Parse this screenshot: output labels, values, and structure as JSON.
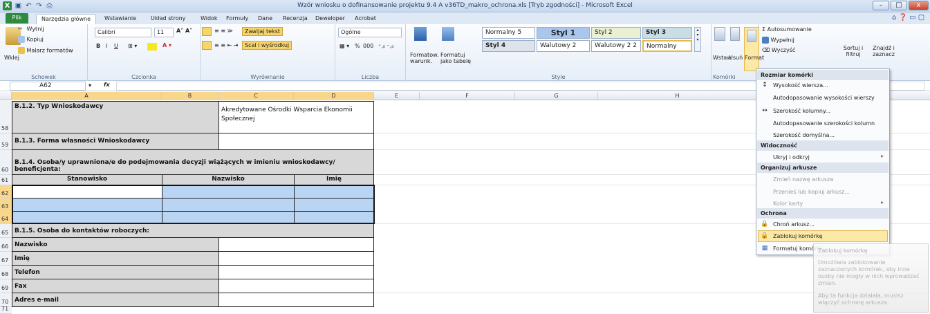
{
  "window": {
    "title": "Wzór wniosku o dofinansowanie projektu 9.4 A v36TD_makro_ochrona.xls [Tryb zgodności] - Microsoft Excel",
    "min": "–",
    "max": "□",
    "close": "x"
  },
  "tabs": [
    "Plik",
    "Narzędzia główne",
    "Wstawianie",
    "Układ strony",
    "Widok",
    "Formuły",
    "Dane",
    "Recenzja",
    "Deweloper",
    "Acrobat"
  ],
  "clipboard": {
    "paste": "Wklej",
    "cut": "Wytnij",
    "copy": "Kopiuj",
    "format_painter": "Malarz formatów",
    "label": "Schowek"
  },
  "font": {
    "name": "Calibri",
    "size": "11",
    "label": "Czcionka",
    "bold": "B",
    "italic": "I",
    "underline": "U"
  },
  "alignment": {
    "wrap": "Zawijaj tekst",
    "merge": "Scal i wyśrodkuj",
    "label": "Wyrównanie"
  },
  "number": {
    "format": "Ogólne",
    "pct": "%",
    "thousands": "000",
    "label": "Liczba"
  },
  "styles": {
    "cond": "Formatow. warunk.",
    "table": "Formatuj jako tabelę",
    "items": [
      "Normalny 5",
      "Styl 1",
      "Styl 2",
      "Styl 3",
      "Styl 4",
      "Walutowy 2",
      "Walutowy 2 2",
      "Normalny"
    ],
    "label": "Style"
  },
  "cells": {
    "insert": "Wstaw",
    "delete": "Usuń",
    "format": "Format",
    "label": "Komórki"
  },
  "editing": {
    "autosum": "Autosumowanie",
    "fill": "Wypełnij",
    "clear": "Wyczyść",
    "sort": "Sortuj i filtruj",
    "find": "Znajdź i zaznacz"
  },
  "formula": {
    "namebox": "A62",
    "fx": "fx"
  },
  "columns": [
    "A",
    "B",
    "C",
    "D",
    "E",
    "F",
    "G",
    "H"
  ],
  "rows": {
    "r58": {
      "num": "58",
      "label": "B.1.2. Typ Wnioskodawcy",
      "value": "Akredytowane Ośrodki Wsparcia Ekonomii Społecznej"
    },
    "r59": {
      "num": "59",
      "label": "B.1.3.  Forma własności Wnioskodawcy"
    },
    "r60": {
      "num": "60",
      "label": "B.1.4. Osoba/y uprawniona/e do podejmowania decyzji wiążących w imieniu wnioskodawcy/ beneficjenta:"
    },
    "r61": {
      "num": "61",
      "h1": "Stanowisko",
      "h2": "Nazwisko",
      "h3": "Imię"
    },
    "r62": {
      "num": "62"
    },
    "r63": {
      "num": "63"
    },
    "r64": {
      "num": "64"
    },
    "r65": {
      "num": "65",
      "label": "B.1.5. Osoba do kontaktów roboczych:"
    },
    "r66": {
      "num": "66",
      "label": "Nazwisko"
    },
    "r67": {
      "num": "67",
      "label": "Imię"
    },
    "r68": {
      "num": "68",
      "label": "Telefon"
    },
    "r69": {
      "num": "69",
      "label": "Fax"
    },
    "r70": {
      "num": "70",
      "label": "Adres e-mail"
    },
    "r71": {
      "num": "71"
    }
  },
  "menu": {
    "h_size": "Rozmiar komórki",
    "row_height": "Wysokość wiersza...",
    "autofit_row": "Autodopasowanie wysokości wierszy",
    "col_width": "Szerokość kolumny...",
    "autofit_col": "Autodopasowanie szerokości kolumn",
    "default_width": "Szerokość domyślna...",
    "h_visibility": "Widoczność",
    "hide": "Ukryj i odkryj",
    "h_organize": "Organizuj arkusze",
    "rename": "Zmień nazwę arkusza",
    "move": "Przenieś lub kopiuj arkusz...",
    "tab_color": "Kolor karty",
    "h_protect": "Ochrona",
    "protect": "Chroń arkusz...",
    "lock": "Zablokuj komórkę",
    "format_cells": "Formatuj komórki..."
  },
  "tooltip": {
    "title": "Zablokuj komórkę",
    "line1": "Umożliwia zablokowanie zaznaczonych komórek, aby inne osoby nie mogły w nich wprowadzać zmian.",
    "line2": "Aby ta funkcja działała, musisz włączyć ochronę arkusza."
  },
  "colors": {
    "file_tab": "#2d8a3e",
    "selection": "#bad4f4",
    "header_cell": "#d8d8d8",
    "menu_highlight": "#fde9a7"
  }
}
